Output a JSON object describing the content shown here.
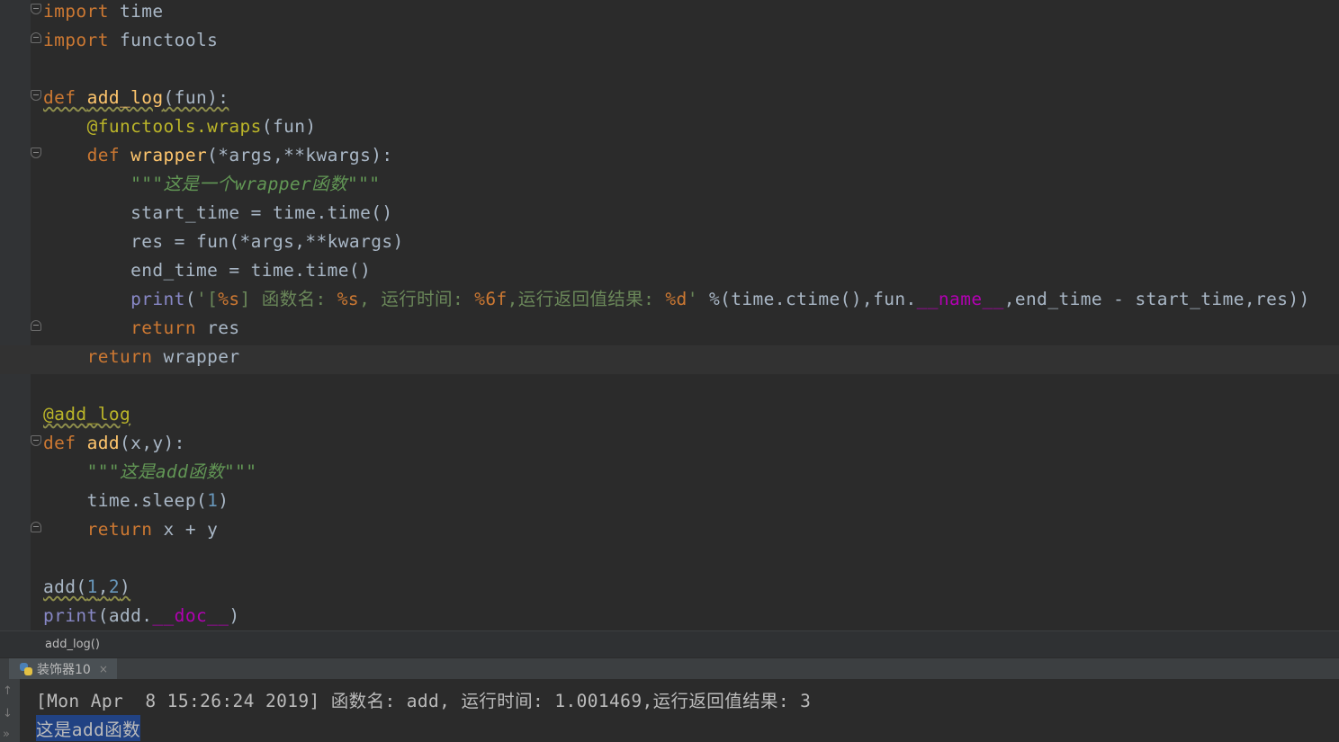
{
  "editor": {
    "code": {
      "l1a": "import",
      "l1b": " time",
      "l2a": "import",
      "l2b": " functools",
      "l4_def": "def",
      "l4_name": "add_log",
      "l4_rest": "(fun):",
      "l5_dec": "@functools.wraps",
      "l5_rest": "(fun)",
      "l6_def": "def",
      "l6_name": "wrapper",
      "l6_rest": "(*args,**kwargs):",
      "l7_q1": "\"\"\"",
      "l7_doc": "这是一个wrapper函数",
      "l7_q2": "\"\"\"",
      "l8": "start_time = time.time()",
      "l9": "res = fun(*args,**kwargs)",
      "l10": "end_time = time.time()",
      "l11_print": "print",
      "l11_open": "(",
      "l11_str1": "'[",
      "l11_fmt1": "%s",
      "l11_str2": "] 函数名: ",
      "l11_fmt2": "%s",
      "l11_str3": ", 运行时间: ",
      "l11_fmt3": "%6f",
      "l11_str4": ",运行返回值结果: ",
      "l11_fmt4": "%d",
      "l11_str5": "'",
      "l11_mid": " %(time.ctime(),fun.",
      "l11_magic": "__name__",
      "l11_end": ",end_time - start_time,res))",
      "l12_kw": "return",
      "l12_rest": " res",
      "l13_kw": "return",
      "l13_rest": " wrapper",
      "l15": "@add_log",
      "l16_def": "def",
      "l16_name": "add",
      "l16_rest": "(x,y):",
      "l17_q1": "\"\"\"",
      "l17_doc": "这是add函数",
      "l17_q2": "\"\"\"",
      "l18_a": "time.sleep(",
      "l18_num": "1",
      "l18_b": ")",
      "l19_kw": "return",
      "l19_rest": " x + y",
      "l21_a": "add(",
      "l21_n1": "1",
      "l21_c": ",",
      "l21_n2": "2",
      "l21_b": ")",
      "l22_print": "print",
      "l22_a": "(add.",
      "l22_magic": "__doc__",
      "l22_b": ")"
    }
  },
  "breadcrumb": {
    "text": "add_log()"
  },
  "run_panel": {
    "tab_label": "装饰器10",
    "tab_close": "×",
    "output": [
      "[Mon Apr  8 15:26:24 2019] 函数名: add, 运行时间: 1.001469,运行返回值结果: 3",
      "这是add函数"
    ]
  },
  "colors": {
    "background": "#2b2b2b",
    "keyword": "#cc7832",
    "function": "#ffc66d",
    "decorator": "#bbb529",
    "string": "#6a8759",
    "number": "#6897bb",
    "magic": "#b200b2",
    "selection": "#214283"
  }
}
